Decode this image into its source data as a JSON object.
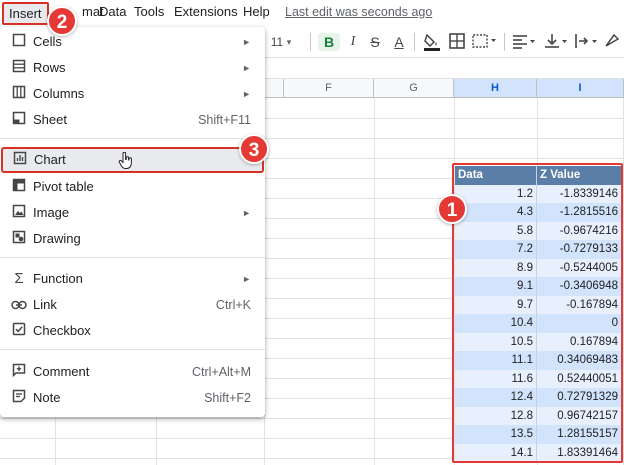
{
  "menubar": {
    "items": [
      "Insert",
      "mat",
      "Data",
      "Tools",
      "Extensions",
      "Help"
    ],
    "last_edit": "Last edit was seconds ago"
  },
  "toolbar": {
    "font_size": "11",
    "bold": "B",
    "italic": "I",
    "strike": "S",
    "text_color": "A"
  },
  "grid": {
    "columns": [
      "F",
      "G",
      "H",
      "I"
    ],
    "selected_columns": [
      "H",
      "I"
    ]
  },
  "table": {
    "headers": [
      "Data",
      "Z Value"
    ],
    "rows": [
      [
        "1.2",
        "-1.8339146"
      ],
      [
        "4.3",
        "-1.2815516"
      ],
      [
        "5.8",
        "-0.9674216"
      ],
      [
        "7.2",
        "-0.7279133"
      ],
      [
        "8.9",
        "-0.5244005"
      ],
      [
        "9.1",
        "-0.3406948"
      ],
      [
        "9.7",
        "-0.167894"
      ],
      [
        "10.4",
        "0"
      ],
      [
        "10.5",
        "0.167894"
      ],
      [
        "11.1",
        "0.34069483"
      ],
      [
        "11.6",
        "0.52440051"
      ],
      [
        "12.4",
        "0.72791329"
      ],
      [
        "12.8",
        "0.96742157"
      ],
      [
        "13.5",
        "1.28155157"
      ],
      [
        "14.1",
        "1.83391464"
      ]
    ]
  },
  "insert_menu": {
    "items": [
      {
        "label": "Cells",
        "icon": "square-icon",
        "shortcut": "",
        "submenu": true
      },
      {
        "label": "Rows",
        "icon": "rows-icon",
        "shortcut": "",
        "submenu": true
      },
      {
        "label": "Columns",
        "icon": "columns-icon",
        "shortcut": "",
        "submenu": true
      },
      {
        "label": "Sheet",
        "icon": "sheet-icon",
        "shortcut": "Shift+F11",
        "submenu": false
      },
      {
        "label": "Chart",
        "icon": "chart-icon",
        "shortcut": "",
        "submenu": false
      },
      {
        "label": "Pivot table",
        "icon": "pivot-table-icon",
        "shortcut": "",
        "submenu": false
      },
      {
        "label": "Image",
        "icon": "image-icon",
        "shortcut": "",
        "submenu": true
      },
      {
        "label": "Drawing",
        "icon": "drawing-icon",
        "shortcut": "",
        "submenu": false
      },
      {
        "label": "Function",
        "icon": "sigma-icon",
        "shortcut": "",
        "submenu": true
      },
      {
        "label": "Link",
        "icon": "link-icon",
        "shortcut": "Ctrl+K",
        "submenu": false
      },
      {
        "label": "Checkbox",
        "icon": "checkbox-icon",
        "shortcut": "",
        "submenu": false
      },
      {
        "label": "Comment",
        "icon": "comment-icon",
        "shortcut": "Ctrl+Alt+M",
        "submenu": false
      },
      {
        "label": "Note",
        "icon": "note-icon",
        "shortcut": "Shift+F2",
        "submenu": false
      }
    ]
  },
  "badges": [
    "1",
    "2",
    "3"
  ],
  "colors": {
    "highlight_red": "#e53935",
    "table_header": "#5b7ea8",
    "table_row_light": "#e8f0fe",
    "table_row_dark": "#d2e3fc"
  }
}
